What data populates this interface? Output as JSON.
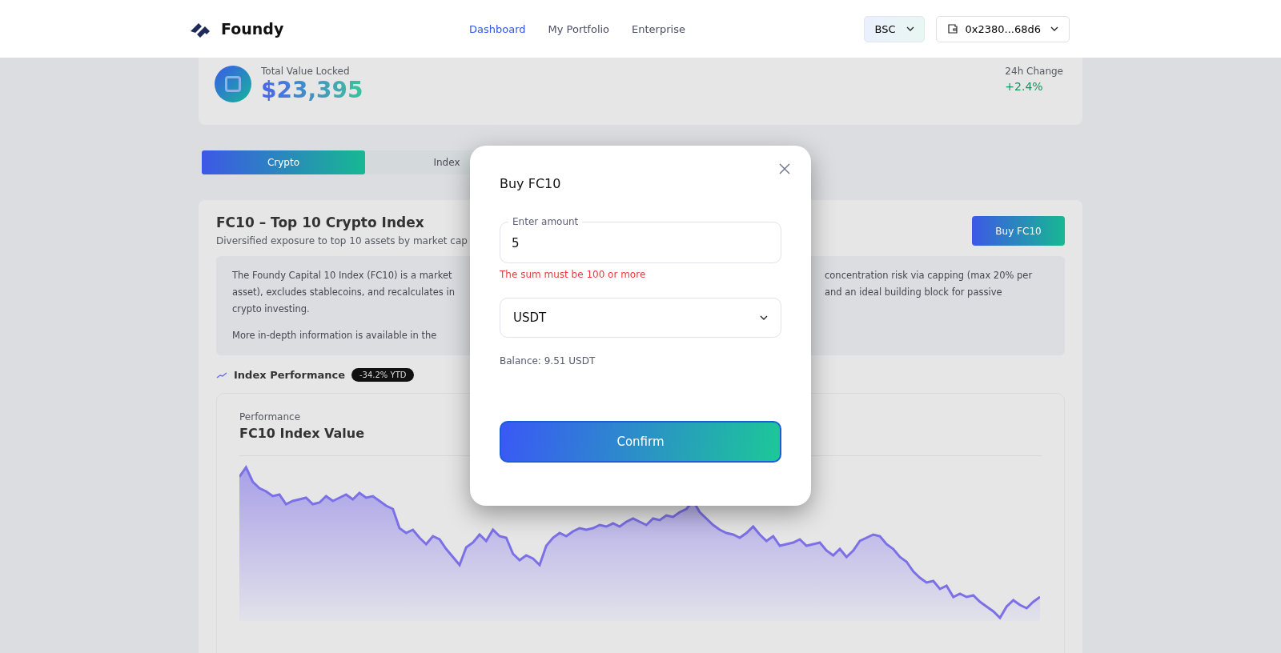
{
  "header": {
    "brand": "Foundy",
    "nav": [
      {
        "label": "Dashboard",
        "selected": true
      },
      {
        "label": "My Portfolio",
        "selected": false
      },
      {
        "label": "Enterprise",
        "selected": false
      }
    ],
    "network": "BSC",
    "wallet": "0x2380...68d6"
  },
  "stats": {
    "tvl_label": "Total Value Locked",
    "tvl_value": "$23,395",
    "change_label": "24h Change",
    "change_value": "+2.4%"
  },
  "tabs": [
    {
      "label": "Crypto",
      "selected": true
    },
    {
      "label": "Index",
      "selected": false
    }
  ],
  "index_card": {
    "title": "FC10 – Top 10 Crypto Index",
    "subtitle": "Diversified exposure to top 10 assets by market cap",
    "buy_button": "Buy FC10",
    "info_left": [
      "The Foundy Capital 10 Index (FC10) is a market",
      "asset), excludes stablecoins, and recalculates in",
      "crypto investing.",
      "More in-depth information is available in the"
    ],
    "info_right": [
      "concentration risk via capping (max 20% per",
      "and an ideal building block for passive"
    ],
    "performance_label": "Index Performance",
    "performance_badge": "-34.2% YTD",
    "chart_kicker": "Performance",
    "chart_title": "FC10 Index Value"
  },
  "modal": {
    "title": "Buy FC10",
    "amount_label": "Enter amount",
    "amount_value": "5",
    "error": "The sum must be 100 or more",
    "currency": "USDT",
    "balance": "Balance: 9.51 USDT",
    "confirm": "Confirm"
  }
}
